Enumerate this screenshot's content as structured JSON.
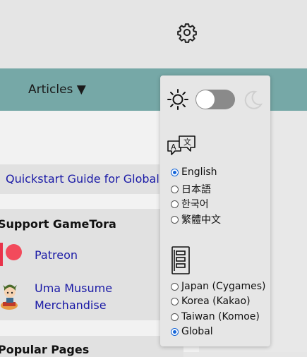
{
  "header": {
    "gear_icon": "gear-icon"
  },
  "nav": {
    "articles_label": "Articles ▼"
  },
  "quickstart": {
    "link_text": "Quickstart Guide for Global"
  },
  "support": {
    "title": "Support GameTora",
    "patreon_label": "Patreon",
    "uma_label_line1": "Uma Musume",
    "uma_label_line2": "Merchandise"
  },
  "popular": {
    "title": "Popular Pages"
  },
  "settings": {
    "theme": {
      "light_icon": "sun-icon",
      "dark_icon": "moon-icon",
      "dark_mode": false
    },
    "language": {
      "icon": "translate-icon",
      "options": [
        "English",
        "日本語",
        "한국어",
        "繁體中文"
      ],
      "selected": "English"
    },
    "server": {
      "icon": "server-icon",
      "options": [
        "Japan (Cygames)",
        "Korea (Kakao)",
        "Taiwan (Komoe)",
        "Global"
      ],
      "selected": "Global"
    }
  },
  "colors": {
    "nav_bar": "#76a8a7",
    "link": "#1a1aa6",
    "patreon": "#f24a5b",
    "radio_selected": "#1565d8"
  }
}
